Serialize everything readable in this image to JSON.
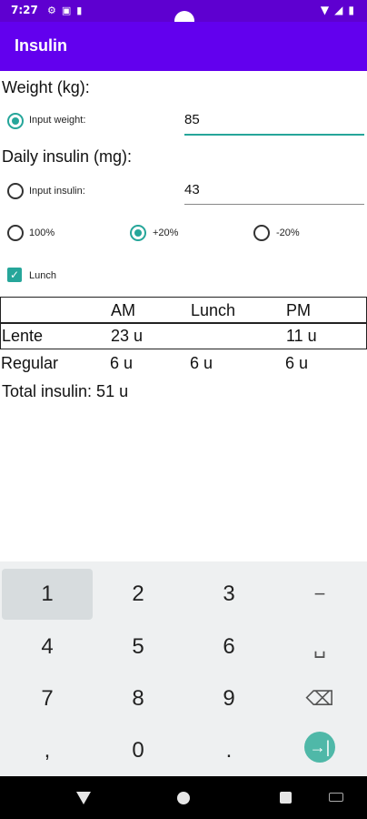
{
  "status_bar": {
    "time": "7:27"
  },
  "app": {
    "title": "Insulin"
  },
  "weight": {
    "section_label": "Weight (kg):",
    "radio_label": "Input weight:",
    "value": "85"
  },
  "insulin": {
    "section_label": "Daily insulin (mg):",
    "radio_label": "Input insulin:",
    "value": "43"
  },
  "adjust": {
    "options": [
      "100%",
      "+20%",
      "-20%"
    ],
    "selected": "+20%"
  },
  "lunch": {
    "label": "Lunch",
    "checked": true
  },
  "table": {
    "headers": [
      "",
      "AM",
      "Lunch",
      "PM"
    ],
    "rows": [
      [
        "Lente",
        "23 u",
        "",
        "11 u"
      ],
      [
        "Regular",
        "6 u",
        "6 u",
        "6 u"
      ]
    ]
  },
  "total": {
    "text": "Total insulin: 51 u"
  },
  "keyboard": {
    "keys": [
      "1",
      "2",
      "3",
      "−",
      "4",
      "5",
      "6",
      "␣",
      "7",
      "8",
      "9",
      "⌫",
      ",",
      "0",
      ".",
      "→|"
    ]
  },
  "colors": {
    "primary": "#6200ee",
    "status": "#5e00d0",
    "accent": "#26a69a"
  }
}
